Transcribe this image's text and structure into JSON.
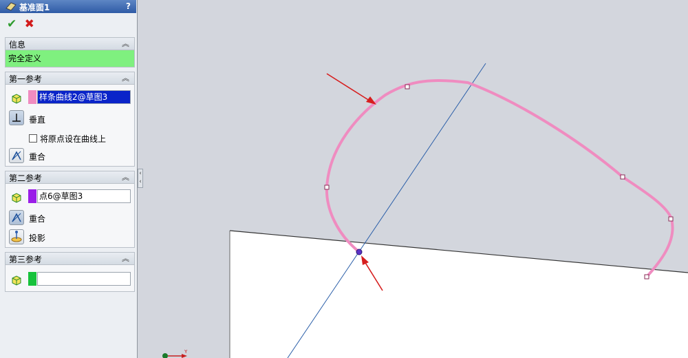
{
  "panel": {
    "title": "基准面1",
    "help": "?",
    "ok_symbol": "✔",
    "cancel_symbol": "✖",
    "info": {
      "header": "信息",
      "status": "完全定义",
      "status_color": "#7ff07f"
    },
    "ref1": {
      "header": "第一参考",
      "field": "样条曲线2@草图3",
      "swatch_color": "#f08cc0",
      "option_perpendicular": "垂直",
      "checkbox_label": "将原点设在曲线上",
      "option_coincident": "重合"
    },
    "ref2": {
      "header": "第二参考",
      "field": "点6@草图3",
      "swatch_color": "#9a1ee8",
      "option_coincident": "重合",
      "option_project": "投影"
    },
    "ref3": {
      "header": "第三参考",
      "field": "",
      "swatch_color": "#17c23c"
    }
  },
  "viewport": {
    "triad_label": "Y",
    "curve_color": "#ef8cc0",
    "arrow_color": "#d61e1e",
    "axis_line_color": "#2a5ea8"
  }
}
